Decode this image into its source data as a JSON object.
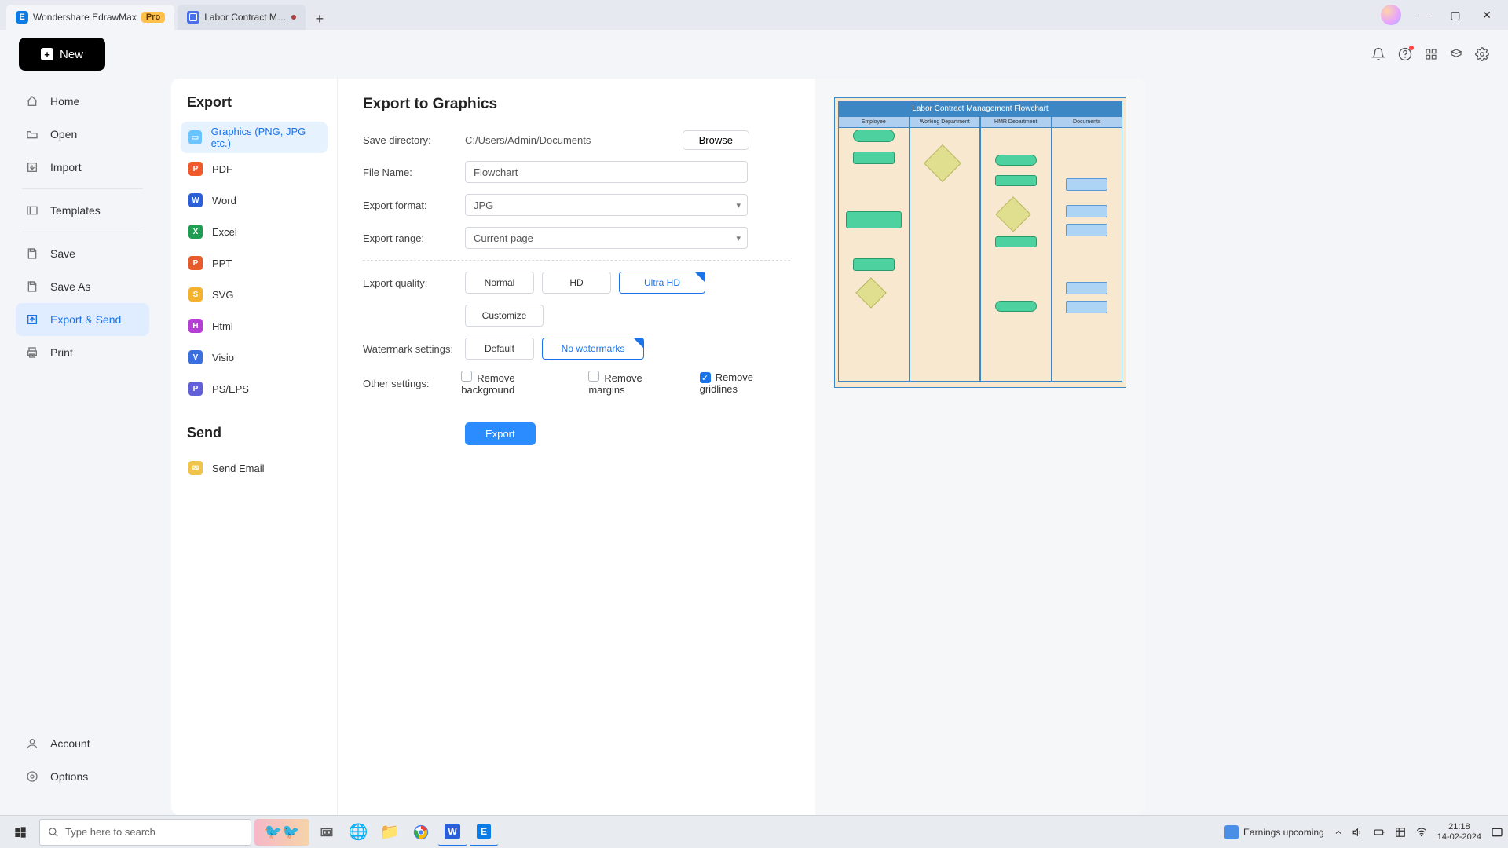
{
  "titlebar": {
    "app_name": "Wondershare EdrawMax",
    "pro_badge": "Pro",
    "doc_tab": "Labor Contract M…",
    "add_tab": "+"
  },
  "window_controls": {
    "minimize": "—",
    "maximize": "▢",
    "close": "✕"
  },
  "toolbar": {
    "new_label": "New"
  },
  "nav": {
    "home": "Home",
    "open": "Open",
    "import": "Import",
    "templates": "Templates",
    "save": "Save",
    "save_as": "Save As",
    "export_send": "Export & Send",
    "print": "Print",
    "account": "Account",
    "options": "Options"
  },
  "export_panel": {
    "heading": "Export",
    "formats": {
      "graphics": "Graphics (PNG, JPG etc.)",
      "pdf": "PDF",
      "word": "Word",
      "excel": "Excel",
      "ppt": "PPT",
      "svg": "SVG",
      "html": "Html",
      "visio": "Visio",
      "pseps": "PS/EPS"
    },
    "send_heading": "Send",
    "send_email": "Send Email"
  },
  "settings": {
    "title": "Export to Graphics",
    "save_dir_label": "Save directory:",
    "save_dir_value": "C:/Users/Admin/Documents",
    "browse": "Browse",
    "file_name_label": "File Name:",
    "file_name_value": "Flowchart",
    "export_format_label": "Export format:",
    "export_format_value": "JPG",
    "export_range_label": "Export range:",
    "export_range_value": "Current page",
    "export_quality_label": "Export quality:",
    "quality_normal": "Normal",
    "quality_hd": "HD",
    "quality_ultra": "Ultra HD",
    "quality_customize": "Customize",
    "watermark_label": "Watermark settings:",
    "watermark_default": "Default",
    "watermark_none": "No watermarks",
    "other_label": "Other settings:",
    "remove_bg": "Remove background",
    "remove_margins": "Remove margins",
    "remove_gridlines": "Remove gridlines",
    "export_btn": "Export"
  },
  "preview": {
    "title": "Labor Contract Management Flowchart",
    "lanes": [
      "Employee",
      "Working Department",
      "HMR Department",
      "Documents"
    ]
  },
  "taskbar": {
    "search_placeholder": "Type here to search",
    "earnings": "Earnings upcoming",
    "time": "21:18",
    "date": "14-02-2024"
  }
}
